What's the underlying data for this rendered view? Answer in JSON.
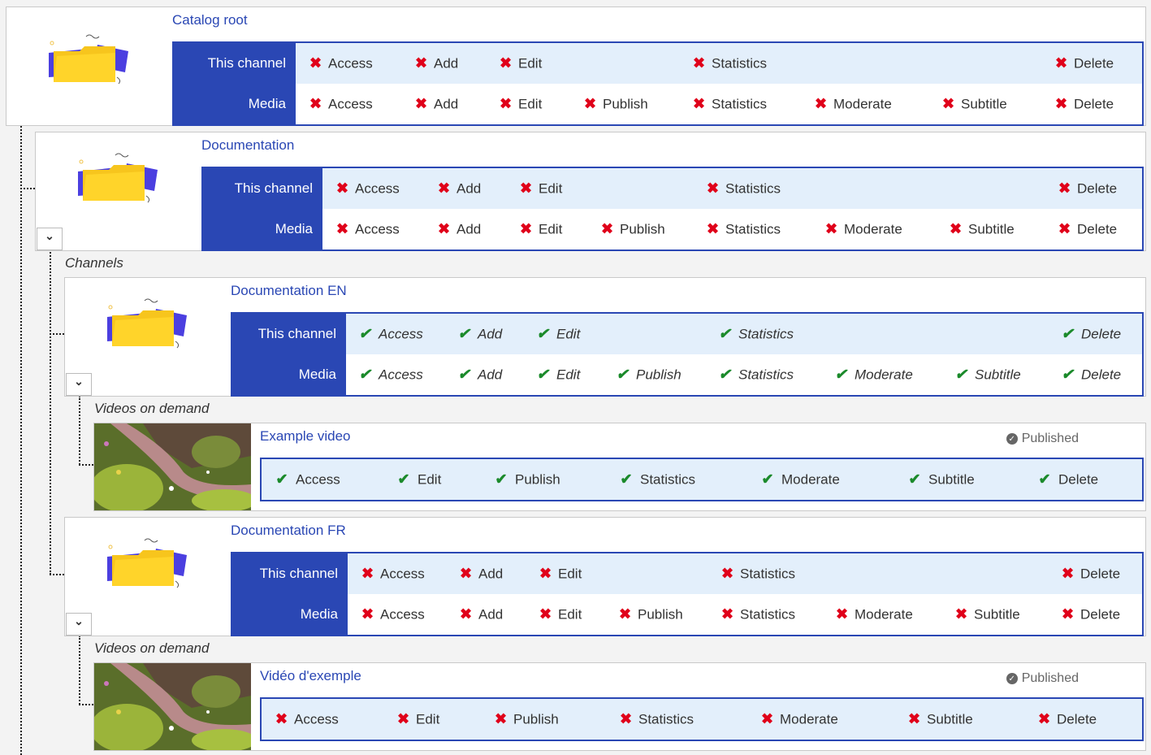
{
  "colors": {
    "accent": "#2a47b4",
    "deny": "#e0001a",
    "allow": "#1b8a2b",
    "row_bg": "#e3effb"
  },
  "icons": {
    "deny": "x-mark-icon",
    "allow": "check-icon",
    "expand": "chevron-down-icon",
    "published": "check-circle-icon",
    "folder": "folder-icon"
  },
  "row_labels": {
    "this_channel": "This channel",
    "media": "Media"
  },
  "perm_names": {
    "access": "Access",
    "add": "Add",
    "edit": "Edit",
    "publish": "Publish",
    "statistics": "Statistics",
    "moderate": "Moderate",
    "subtitle": "Subtitle",
    "delete": "Delete"
  },
  "catalog_root": {
    "title": "Catalog root",
    "status": "deny"
  },
  "documentation": {
    "title": "Documentation",
    "status": "deny",
    "group_label": "Channels",
    "children": {
      "en": {
        "title": "Documentation EN",
        "status": "allow",
        "group_label": "Videos on demand",
        "video": {
          "title": "Example video",
          "status_text": "Published",
          "perm": "allow"
        }
      },
      "fr": {
        "title": "Documentation FR",
        "status": "deny",
        "group_label": "Videos on demand",
        "video": {
          "title": "Vidéo d'exemple",
          "status_text": "Published",
          "perm": "deny"
        }
      }
    }
  },
  "glyphs": {
    "deny": "✖",
    "allow": "✔",
    "chevron": "⌄",
    "published_dot": "✓"
  }
}
